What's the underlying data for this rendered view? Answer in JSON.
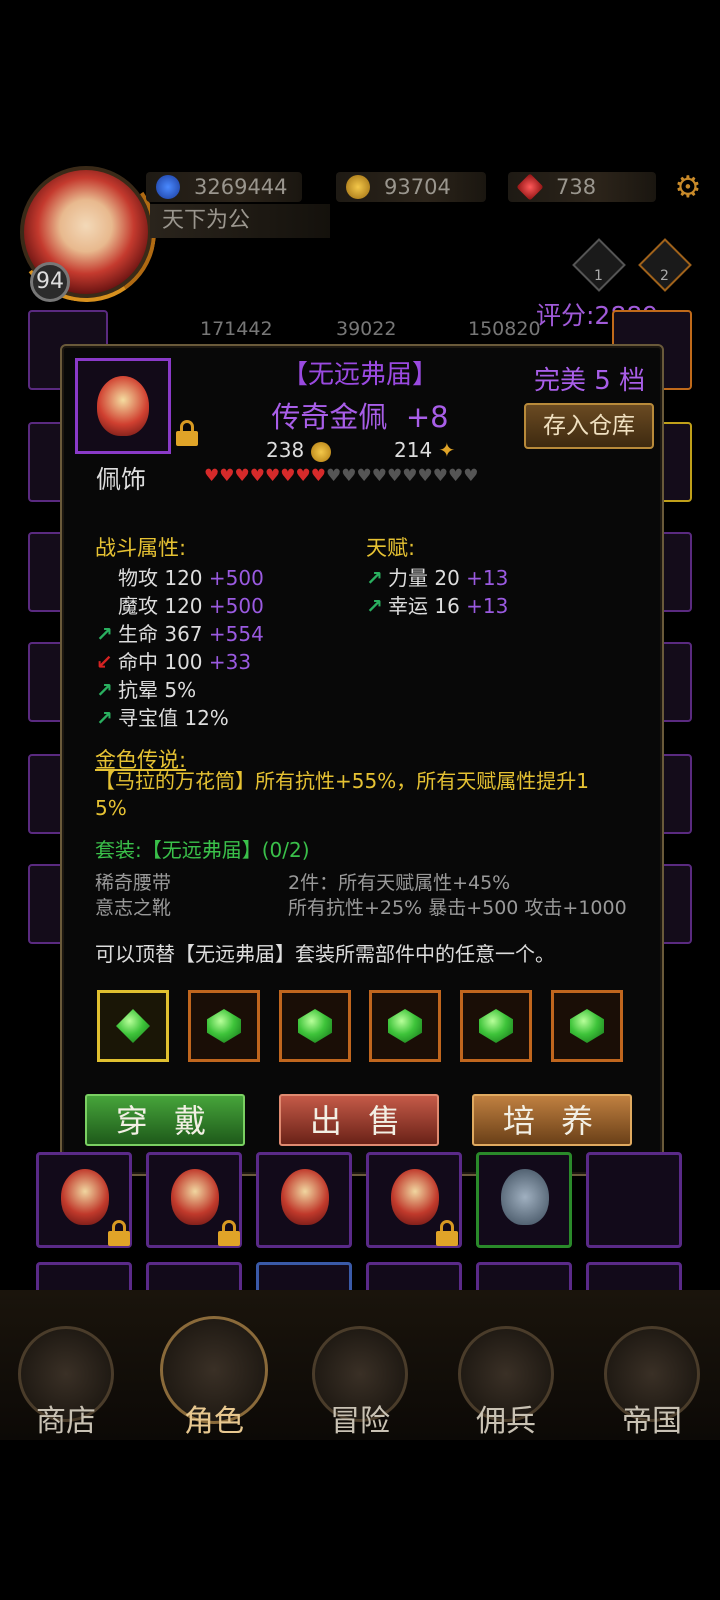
{
  "header": {
    "player_level": "94",
    "guild_name": "天下为公",
    "resources": [
      {
        "icon": "blue-gem-icon",
        "value": "3269444"
      },
      {
        "icon": "gold-coin-icon",
        "value": "93704"
      },
      {
        "icon": "red-crystal-icon",
        "value": "738"
      }
    ],
    "rank_badges": [
      "1",
      "2"
    ],
    "score_label": "评分:2889"
  },
  "background_stats": [
    "171442",
    "39022",
    "150820"
  ],
  "item": {
    "set_name": "【无远弗届】",
    "name": "传奇金佩",
    "enhance": "+8",
    "grade": "完美 5 档",
    "store_button": "存入仓库",
    "coin_value": "238",
    "shard_value": "214",
    "slot_type": "佩饰",
    "hearts_filled": 8,
    "hearts_total": 18,
    "combat_title": "战斗属性:",
    "combat_stats": [
      {
        "arrow": "none",
        "name": "物攻 120",
        "bonus": "+500"
      },
      {
        "arrow": "none",
        "name": "魔攻 120",
        "bonus": "+500"
      },
      {
        "arrow": "up",
        "name": "生命 367",
        "bonus": "+554"
      },
      {
        "arrow": "down",
        "name": "命中 100",
        "bonus": "+33"
      },
      {
        "arrow": "up",
        "name": "抗晕 5%",
        "bonus": ""
      },
      {
        "arrow": "up",
        "name": "寻宝值 12%",
        "bonus": ""
      }
    ],
    "talent_title": "天赋:",
    "talent_stats": [
      {
        "arrow": "up",
        "name": "力量 20",
        "bonus": "+13"
      },
      {
        "arrow": "up",
        "name": "幸运 16",
        "bonus": "+13"
      }
    ],
    "legend_title": "金色传说:",
    "legend_line1": "【马拉的万花筒】所有抗性+55%，所有天赋属性提升1",
    "legend_line2": "5%",
    "set_label": "套装:【无远弗届】(0/2)",
    "set_parts": [
      {
        "part": "稀奇腰带",
        "effect": "2件：所有天赋属性+45%"
      },
      {
        "part": "意志之靴",
        "effect": "所有抗性+25% 暴击+500 攻击+1000"
      }
    ],
    "replace_note": "可以顶替【无远弗届】套装所需部件中的任意一个。",
    "gem_count": 6,
    "buttons": {
      "equip": "穿 戴",
      "sell": "出 售",
      "train": "培 养"
    }
  },
  "nav": [
    {
      "label": "商店",
      "icon": "castle-icon"
    },
    {
      "label": "角色",
      "icon": "hooded-character-icon",
      "active": true
    },
    {
      "label": "冒险",
      "icon": "crossed-swords-icon"
    },
    {
      "label": "佣兵",
      "icon": "mercenary-card-icon"
    },
    {
      "label": "帝国",
      "icon": "crown-icon"
    }
  ],
  "colors": {
    "legendary_purple": "#a85ee8",
    "gold_text": "#e6c233",
    "set_green": "#3ac04a",
    "bonus_purple": "#9a5ae0"
  }
}
